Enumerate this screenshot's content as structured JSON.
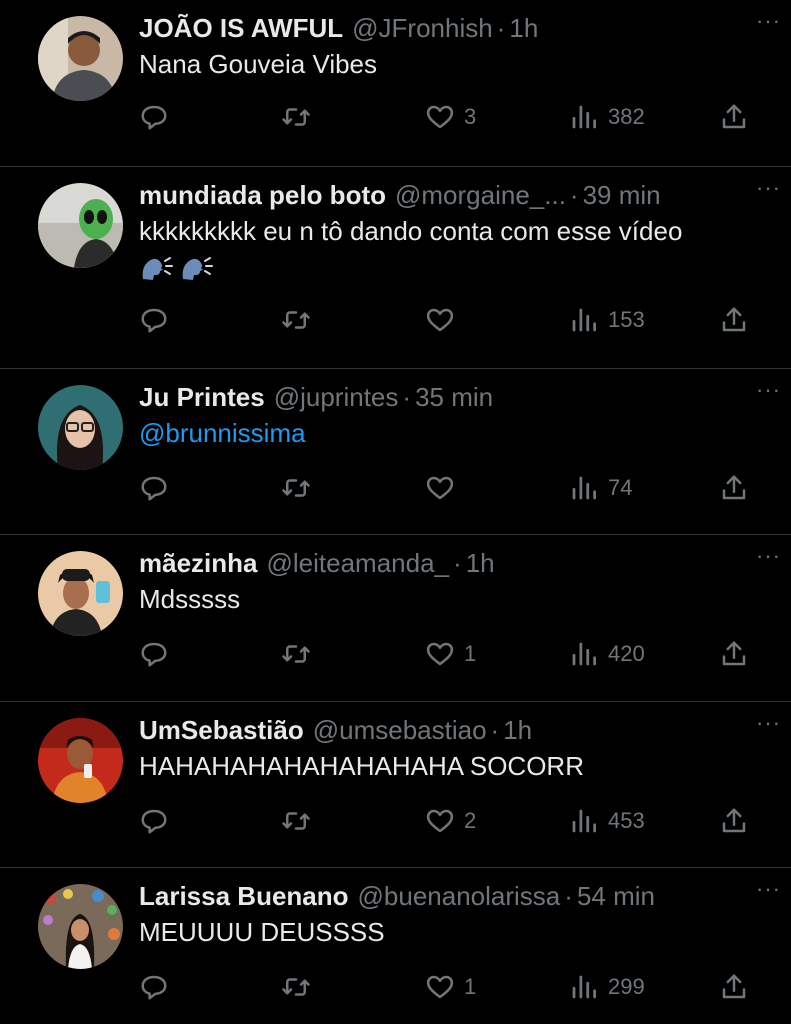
{
  "tweets": [
    {
      "name": "JOÃO IS AWFUL",
      "handle": "@JFronhish",
      "dot": "·",
      "time": "1h",
      "more": "···",
      "text": "Nana Gouveia Vibes",
      "likes": "3",
      "views": "382"
    },
    {
      "name": "mundiada pelo boto",
      "handle": "@morgaine_...",
      "dot": "·",
      "time": "39 min",
      "more": "···",
      "text": "kkkkkkkkk eu n tô dando conta com esse vídeo",
      "emoji": [
        "speaking-head-emoji",
        "speaking-head-emoji"
      ],
      "likes": "",
      "views": "153"
    },
    {
      "name": "Ju Printes",
      "handle": "@juprintes",
      "dot": "·",
      "time": "35 min",
      "more": "···",
      "text": "@brunnissima",
      "likes": "",
      "views": "74"
    },
    {
      "name": "mãezinha",
      "handle": "@leiteamanda_",
      "dot": "·",
      "time": "1h",
      "more": "···",
      "text": "Mdsssss",
      "likes": "1",
      "views": "420"
    },
    {
      "name": "UmSebastião",
      "handle": "@umsebastiao",
      "dot": "·",
      "time": "1h",
      "more": "···",
      "text": "HAHAHAHAHAHAHAHAHA SOCORR",
      "likes": "2",
      "views": "453"
    },
    {
      "name": "Larissa Buenano",
      "handle": "@buenanolarissa",
      "dot": "·",
      "time": "54 min",
      "more": "···",
      "text": "MEUUUU DEUSSSS",
      "likes": "1",
      "views": "299"
    }
  ],
  "colors": {
    "background": "#000000",
    "text": "#e7e9ea",
    "secondary": "#71767b",
    "link": "#1d9bf0",
    "divider": "#2f3336"
  },
  "icons": [
    "reply-icon",
    "retweet-icon",
    "like-icon",
    "views-icon",
    "share-icon",
    "more-icon"
  ]
}
